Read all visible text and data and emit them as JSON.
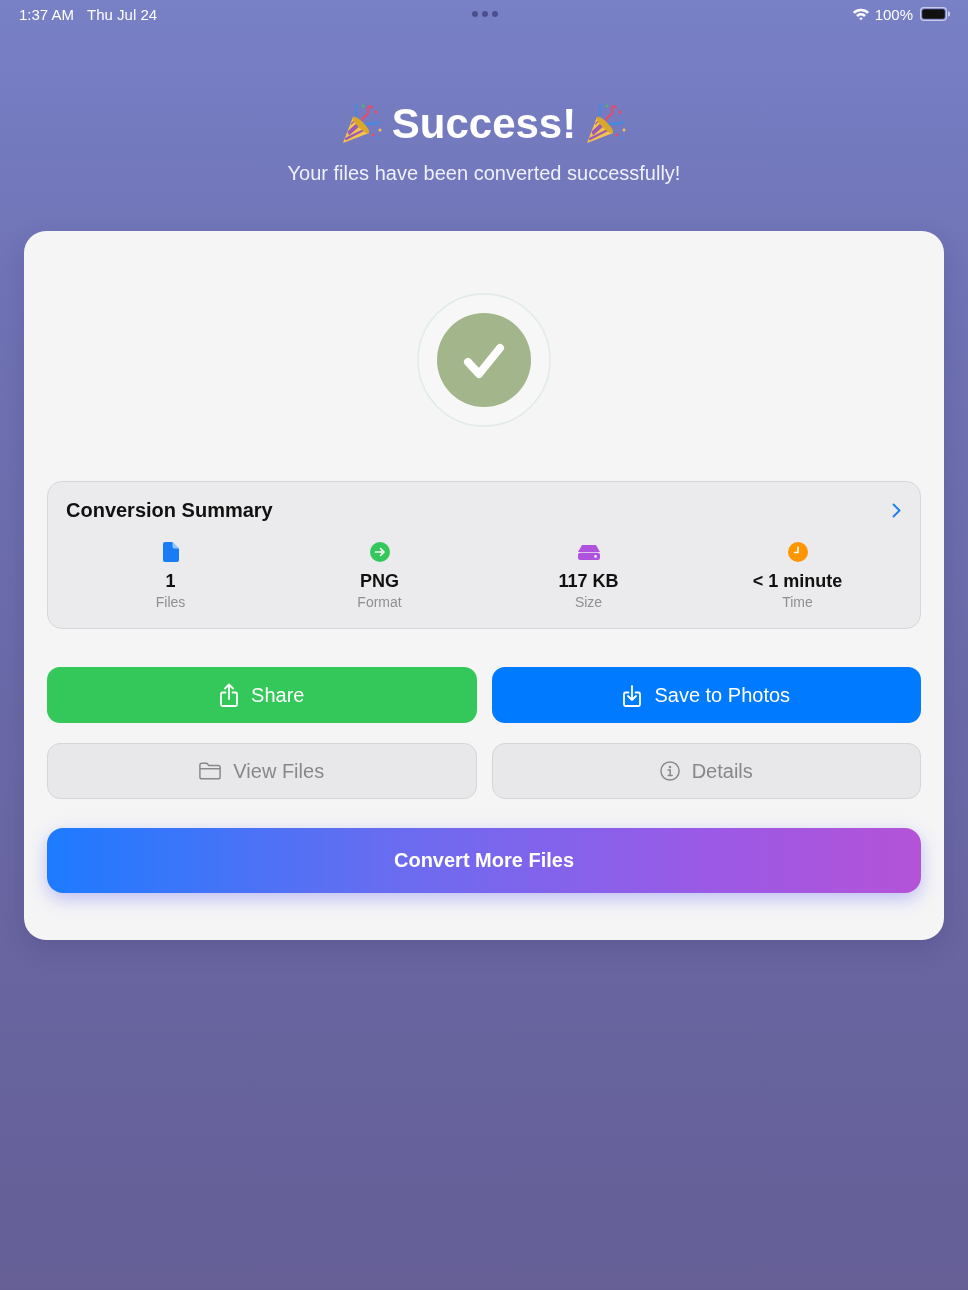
{
  "status_bar": {
    "time": "1:37 AM",
    "date": "Thu Jul 24",
    "battery": "100%"
  },
  "header": {
    "title": "Success!",
    "subtitle": "Your files have been converted successfully!"
  },
  "summary": {
    "title": "Conversion Summary",
    "stats": [
      {
        "value": "1",
        "label": "Files",
        "color": "#1a7cf5"
      },
      {
        "value": "PNG",
        "label": "Format",
        "color": "#34c759"
      },
      {
        "value": "117 KB",
        "label": "Size",
        "color": "#af52de"
      },
      {
        "value": "< 1 minute",
        "label": "Time",
        "color": "#ff9500"
      }
    ]
  },
  "actions": [
    {
      "label": "Share",
      "kind": "filled",
      "color": "#34c759"
    },
    {
      "label": "Save to Photos",
      "kind": "filled",
      "color": "#007aff"
    },
    {
      "label": "View Files",
      "kind": "plain"
    },
    {
      "label": "Details",
      "kind": "plain"
    }
  ],
  "primary_action": {
    "label": "Convert More Files"
  }
}
